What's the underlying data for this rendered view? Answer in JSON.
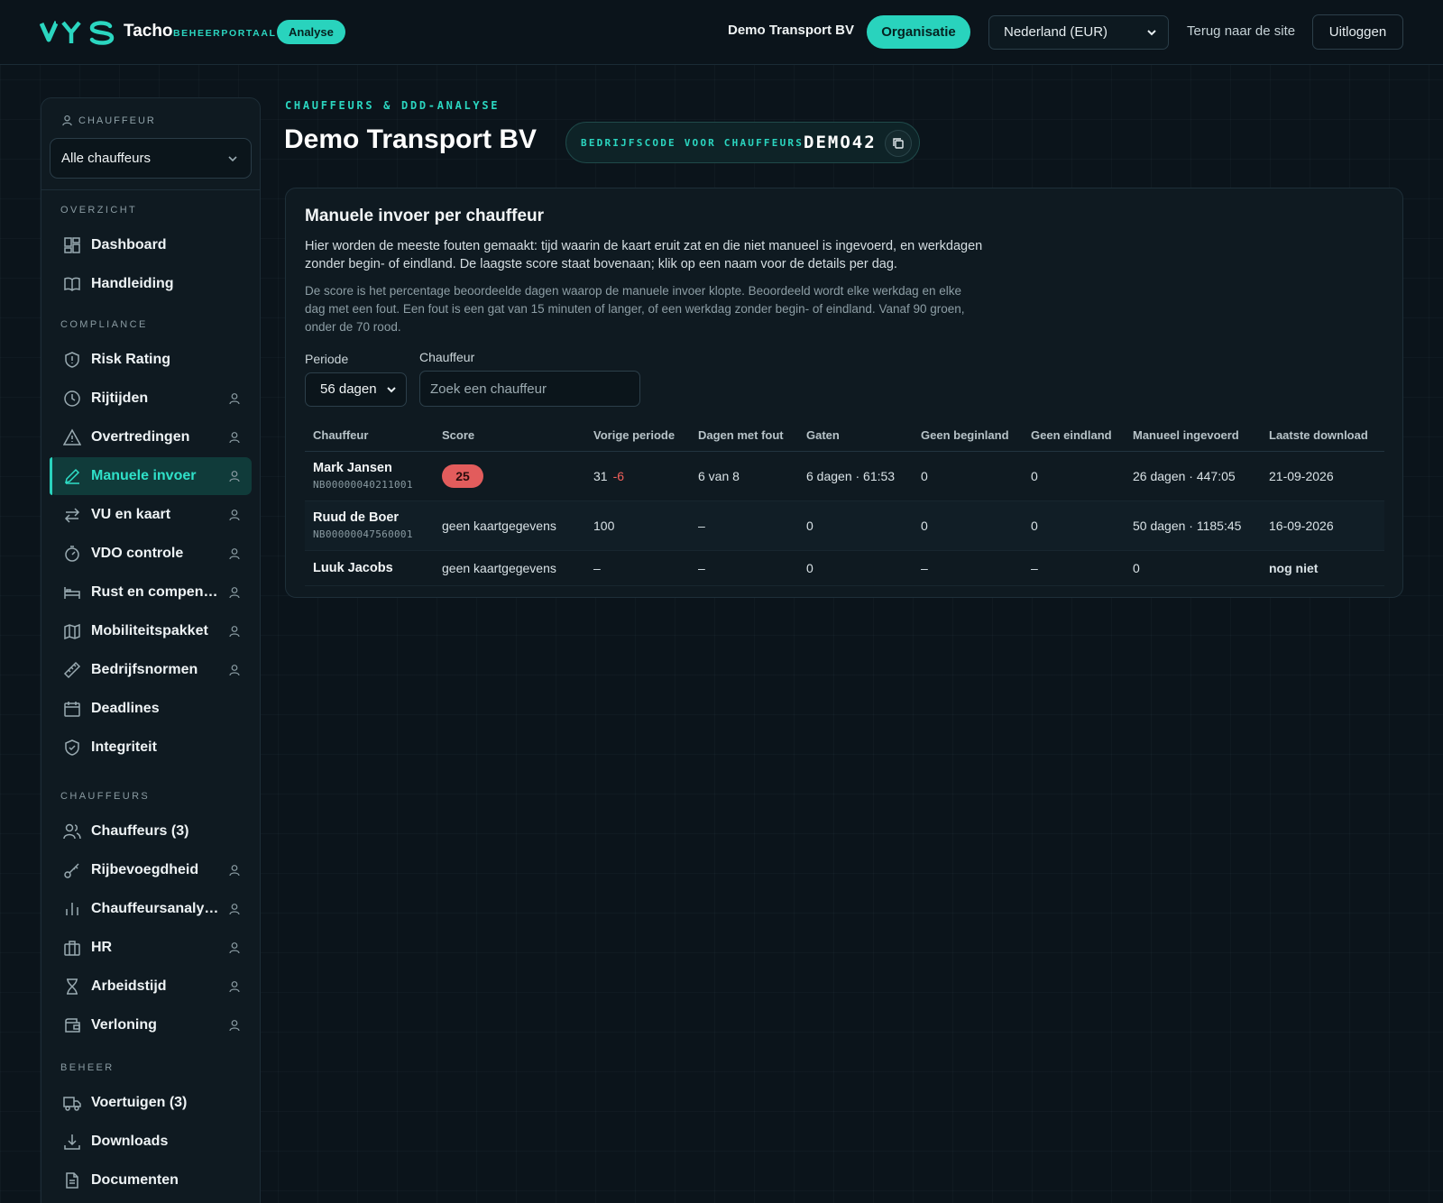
{
  "topbar": {
    "brand_logo": "VYS",
    "brand_name": "Tacho",
    "brand_sub": "BEHEERPORTAAL",
    "analyse_pill": "Analyse",
    "org_name": "Demo Transport BV",
    "org_button": "Organisatie",
    "country_select": "Nederland (EUR)",
    "back_link": "Terug naar de site",
    "logout_button": "Uitloggen"
  },
  "sidebar": {
    "chauffeur_label": "CHAUFFEUR",
    "chauffeur_select": "Alle chauffeurs",
    "sections": {
      "overzicht": "OVERZICHT",
      "compliance": "COMPLIANCE",
      "chauffeurs": "CHAUFFEURS",
      "beheer": "BEHEER"
    },
    "items": {
      "dashboard": "Dashboard",
      "handleiding": "Handleiding",
      "risk_rating": "Risk Rating",
      "rijtijden": "Rijtijden",
      "overtredingen": "Overtredingen",
      "manuele_invoer": "Manuele invoer",
      "vu_en_kaart": "VU en kaart",
      "vdo_controle": "VDO controle",
      "rust": "Rust en compen…",
      "mobiliteitspakket": "Mobiliteitspakket",
      "bedrijfsnormen": "Bedrijfsnormen",
      "deadlines": "Deadlines",
      "integriteit": "Integriteit",
      "chauffeurs": "Chauffeurs (3)",
      "rijbevoegdheid": "Rijbevoegdheid",
      "chauffeursanalyse": "Chauffeursanaly…",
      "hr": "HR",
      "arbeidstijd": "Arbeidstijd",
      "verloning": "Verloning",
      "voertuigen": "Voertuigen (3)",
      "downloads": "Downloads",
      "documenten": "Documenten"
    }
  },
  "header": {
    "eyebrow": "CHAUFFEURS & DDD-ANALYSE",
    "title": "Demo Transport BV",
    "code_label": "BEDRIJFSCODE VOOR CHAUFFEURS",
    "code_value": "DEMO42"
  },
  "card": {
    "title": "Manuele invoer per chauffeur",
    "description": "Hier worden de meeste fouten gemaakt: tijd waarin de kaart eruit zat en die niet manueel is ingevoerd, en werkdagen zonder begin- of eindland. De laagste score staat bovenaan; klik op een naam voor de details per dag.",
    "note": "De score is het percentage beoordeelde dagen waarop de manuele invoer klopte. Beoordeeld wordt elke werkdag en elke dag met een fout. Een fout is een gat van 15 minuten of langer, of een werkdag zonder begin- of eindland. Vanaf 90 groen, onder de 70 rood.",
    "periode_label": "Periode",
    "periode_value": "56 dagen",
    "chauffeur_label": "Chauffeur",
    "search_placeholder": "Zoek een chauffeur"
  },
  "table": {
    "headers": [
      "Chauffeur",
      "Score",
      "Vorige periode",
      "Dagen met fout",
      "Gaten",
      "Geen beginland",
      "Geen eindland",
      "Manueel ingevoerd",
      "Laatste download"
    ],
    "rows": [
      {
        "name": "Mark Jansen",
        "card": "NB00000040211001",
        "score": "25",
        "prev": "31",
        "delta": "-6",
        "days_error": "6 van 8",
        "gaps": "6 dagen · 61:53",
        "no_begin": "0",
        "no_end": "0",
        "manual": "26 dagen · 447:05",
        "last_download": "21-09-2026"
      },
      {
        "name": "Ruud de Boer",
        "card": "NB00000047560001",
        "score": "geen kaartgegevens",
        "prev": "100",
        "days_error": "–",
        "gaps": "0",
        "no_begin": "0",
        "no_end": "0",
        "manual": "50 dagen · 1185:45",
        "last_download": "16-09-2026"
      },
      {
        "name": "Luuk Jacobs",
        "score": "geen kaartgegevens",
        "prev": "–",
        "days_error": "–",
        "gaps": "0",
        "no_begin": "–",
        "no_end": "–",
        "manual": "0",
        "last_download": "nog niet"
      }
    ]
  },
  "colors": {
    "accent": "#29d3bd",
    "background": "#0b141b",
    "danger": "#e25c5c",
    "warning": "#f6a623"
  }
}
